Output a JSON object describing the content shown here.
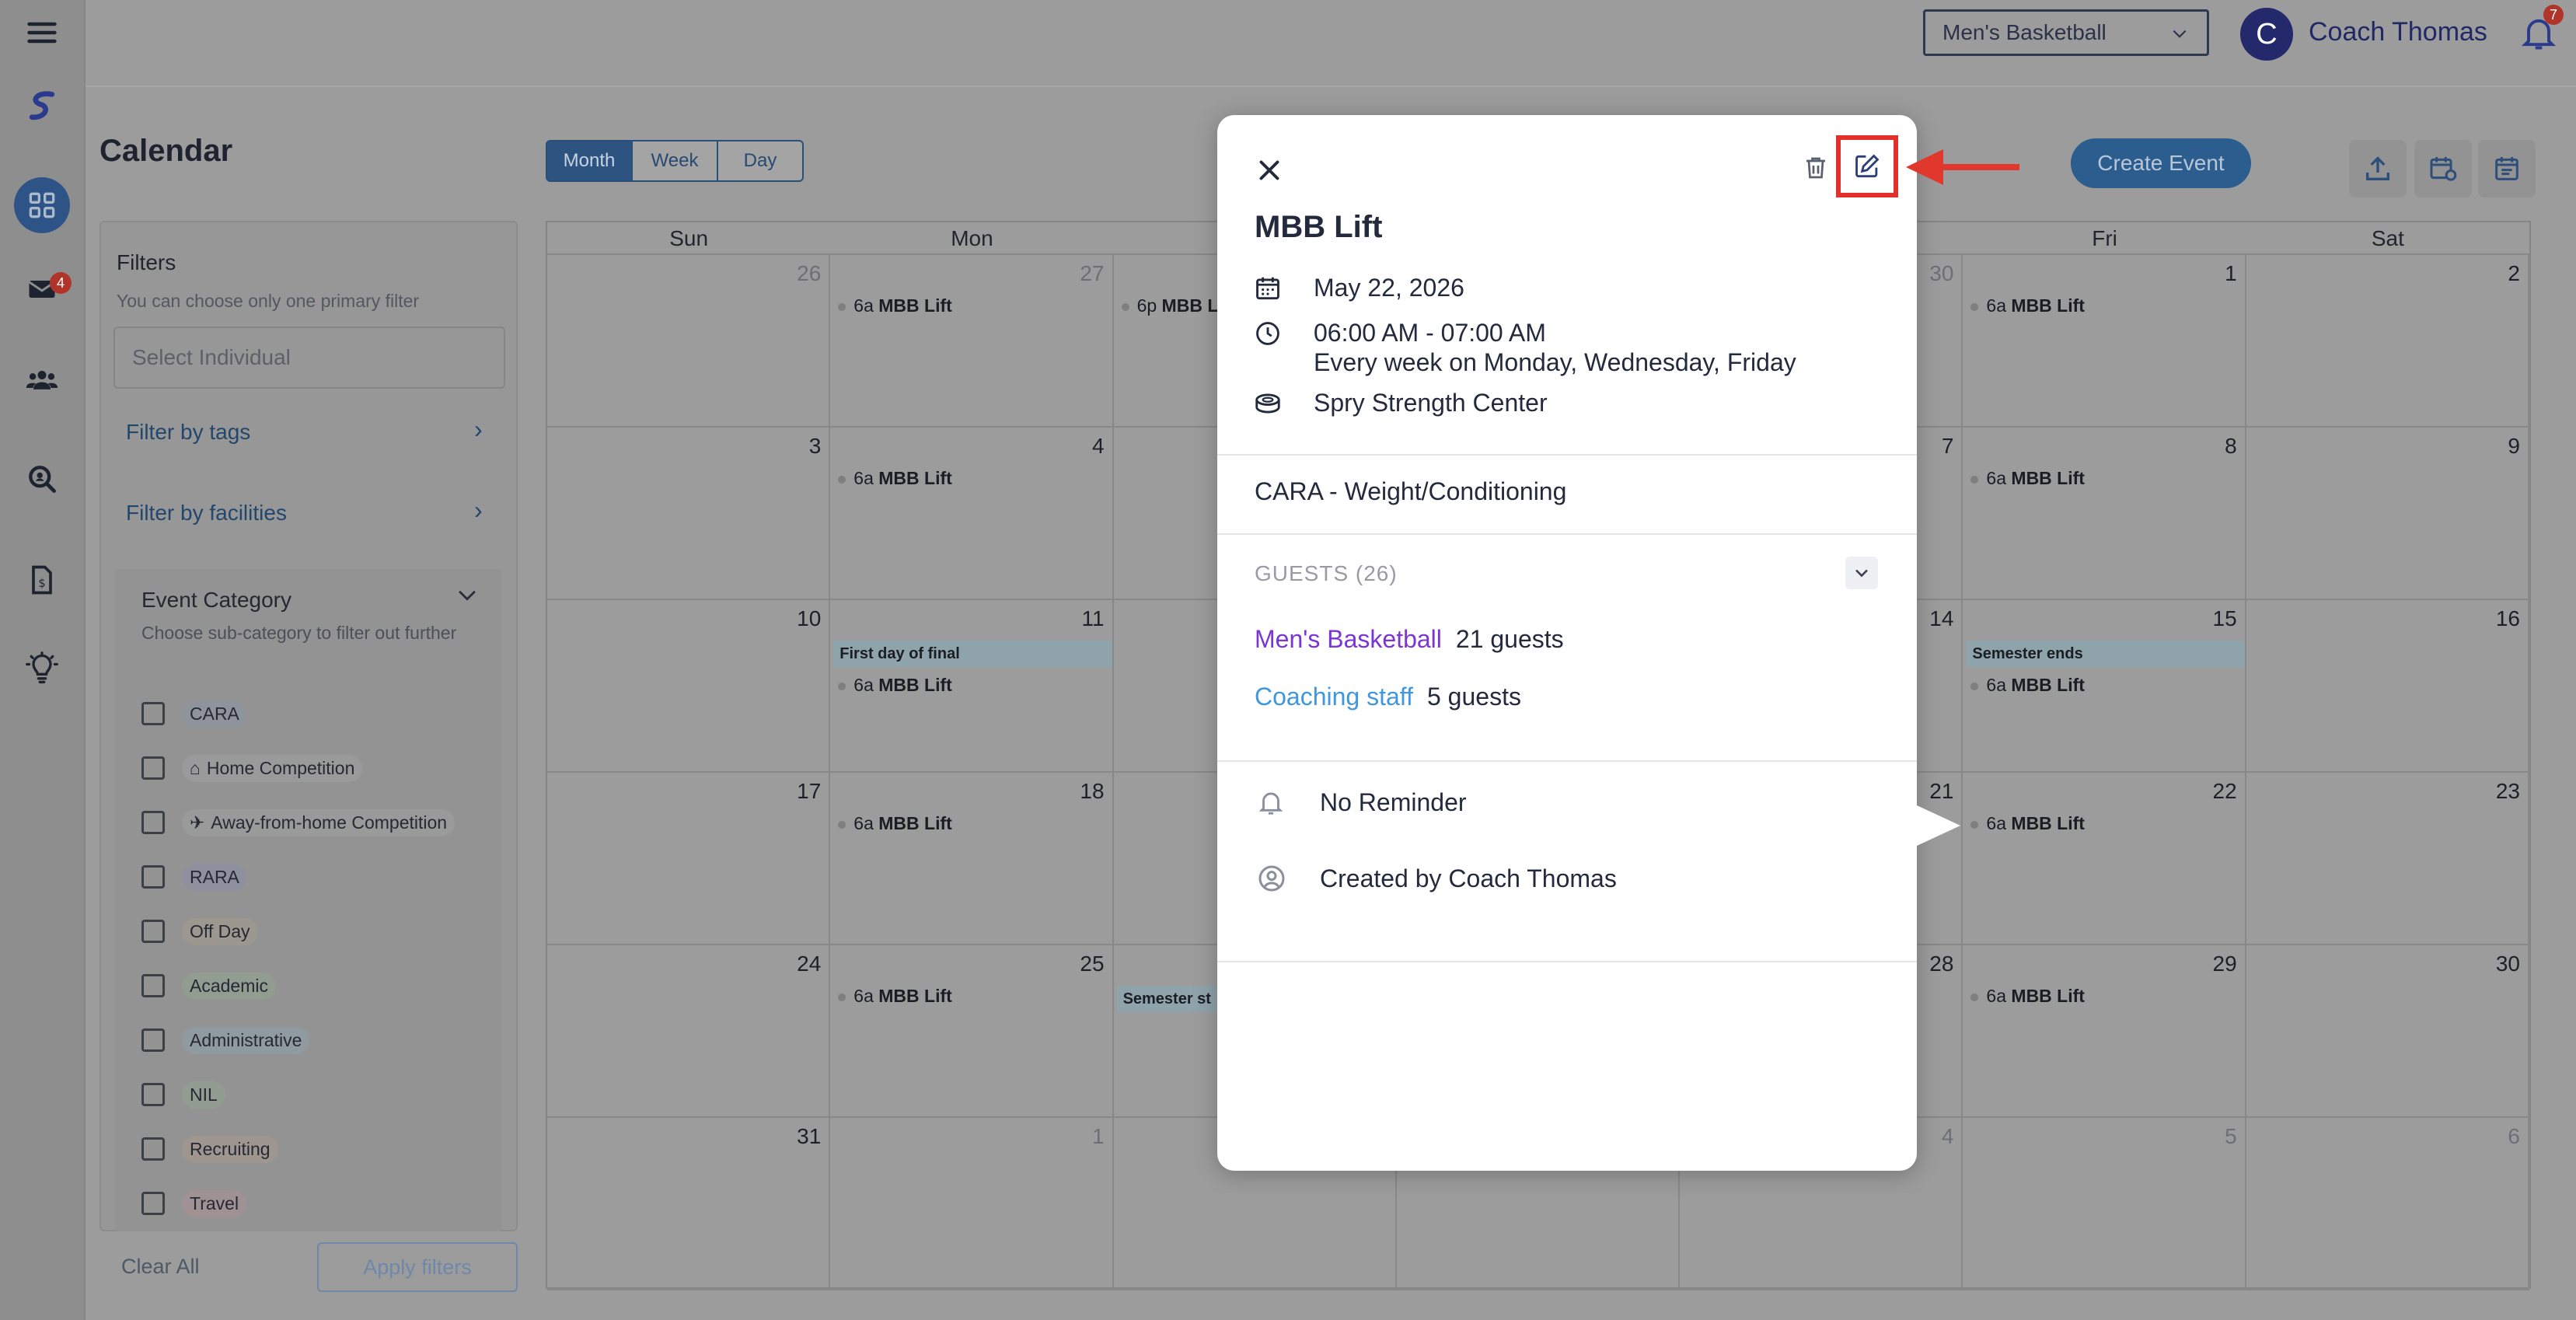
{
  "header": {
    "team_select": "Men's Basketball",
    "avatar_initial": "C",
    "user_name": "Coach Thomas",
    "notification_count": "7"
  },
  "sidebar": {
    "messages_badge": "4"
  },
  "page": {
    "title": "Calendar",
    "views": [
      "Month",
      "Week",
      "Day"
    ],
    "active_view": "Month",
    "create_button": "Create Event"
  },
  "filters": {
    "title": "Filters",
    "subtitle": "You can choose only one primary filter",
    "individual_placeholder": "Select Individual",
    "filter_by_tags": "Filter by tags",
    "filter_by_facilities": "Filter by facilities",
    "category_title": "Event Category",
    "category_subtitle": "Choose sub-category to filter out further",
    "categories": [
      {
        "label": "CARA",
        "color": "#8e939c",
        "icon": ""
      },
      {
        "label": "Home Competition",
        "color": "#9a9a9a",
        "icon": "home-icon"
      },
      {
        "label": "Away-from-home Competition",
        "color": "#9a9a9a",
        "icon": "plane-icon"
      },
      {
        "label": "RARA",
        "color": "#8f909e",
        "icon": ""
      },
      {
        "label": "Off Day",
        "color": "#9c9890",
        "icon": ""
      },
      {
        "label": "Academic",
        "color": "#909d90",
        "icon": ""
      },
      {
        "label": "Administrative",
        "color": "#8f9ba0",
        "icon": ""
      },
      {
        "label": "NIL",
        "color": "#929d92",
        "icon": ""
      },
      {
        "label": "Recruiting",
        "color": "#a09690",
        "icon": ""
      },
      {
        "label": "Travel",
        "color": "#a09292",
        "icon": ""
      }
    ],
    "clear_all": "Clear All",
    "apply": "Apply filters"
  },
  "calendar": {
    "weekdays": [
      "Sun",
      "Mon",
      "Tue",
      "Wed",
      "Thu",
      "Fri",
      "Sat"
    ],
    "weeks": [
      [
        {
          "d": "26",
          "muted": true
        },
        {
          "d": "27",
          "muted": true,
          "ev": "MBB Lift",
          "t": "6a"
        },
        {
          "d": "",
          "ev": "MBB L",
          "t": "6p"
        },
        {
          "d": ""
        },
        {
          "d": "30",
          "muted": true
        },
        {
          "d": "1",
          "ev": "MBB Lift",
          "t": "6a"
        },
        {
          "d": "2"
        }
      ],
      [
        {
          "d": "3"
        },
        {
          "d": "4",
          "ev": "MBB Lift",
          "t": "6a"
        },
        {
          "d": ""
        },
        {
          "d": ""
        },
        {
          "d": "7"
        },
        {
          "d": "8",
          "ev": "MBB Lift",
          "t": "6a"
        },
        {
          "d": "9"
        }
      ],
      [
        {
          "d": "10"
        },
        {
          "d": "11",
          "bar": "First day of final",
          "ev": "MBB Lift",
          "t": "6a"
        },
        {
          "d": ""
        },
        {
          "d": ""
        },
        {
          "d": "14"
        },
        {
          "d": "15",
          "bar": "Semester ends",
          "ev": "MBB Lift",
          "t": "6a"
        },
        {
          "d": "16"
        }
      ],
      [
        {
          "d": "17"
        },
        {
          "d": "18",
          "ev": "MBB Lift",
          "t": "6a"
        },
        {
          "d": ""
        },
        {
          "d": ""
        },
        {
          "d": "21"
        },
        {
          "d": "22",
          "ev": "MBB Lift",
          "t": "6a"
        },
        {
          "d": "23"
        }
      ],
      [
        {
          "d": "24"
        },
        {
          "d": "25",
          "ev": "MBB Lift",
          "t": "6a"
        },
        {
          "d": "",
          "bar": "Semester st"
        },
        {
          "d": ""
        },
        {
          "d": "28"
        },
        {
          "d": "29",
          "ev": "MBB Lift",
          "t": "6a"
        },
        {
          "d": "30"
        }
      ],
      [
        {
          "d": "31"
        },
        {
          "d": "1",
          "muted": true
        },
        {
          "d": ""
        },
        {
          "d": ""
        },
        {
          "d": "4",
          "muted": true
        },
        {
          "d": "5",
          "muted": true
        },
        {
          "d": "6",
          "muted": true
        }
      ]
    ]
  },
  "event_modal": {
    "title": "MBB Lift",
    "date": "May 22, 2026",
    "time": "06:00 AM - 07:00 AM",
    "recurrence": "Every week on Monday, Wednesday, Friday",
    "location": "Spry Strength Center",
    "category": "CARA - Weight/Conditioning",
    "guests_label": "GUESTS (26)",
    "guest_groups": [
      {
        "name": "Men's Basketball",
        "count": "21 guests",
        "color": "#7b35d6"
      },
      {
        "name": "Coaching staff",
        "count": "5 guests",
        "color": "#3f97e0"
      }
    ],
    "reminder": "No Reminder",
    "created_by": "Created by Coach Thomas"
  },
  "colors": {
    "accent": "#2d5480",
    "highlight": "#e2312b"
  }
}
